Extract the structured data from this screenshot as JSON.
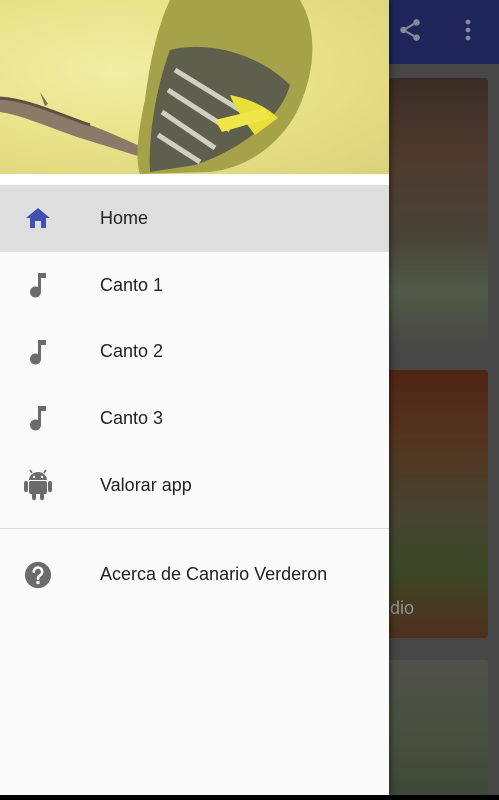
{
  "app": {
    "card_caption": "dio",
    "colors": {
      "toolbar": "#2d3a8c",
      "active_item": "#dedede",
      "home_icon": "#3f51b5",
      "menu_icon": "#6b6b6b"
    }
  },
  "toolbar": {
    "share_icon": "share-icon",
    "more_icon": "more-vert-icon"
  },
  "drawer": {
    "header_image": "yellow-bird-on-branch",
    "items": [
      {
        "label": "Home",
        "icon": "home-icon",
        "active": true
      },
      {
        "label": "Canto 1",
        "icon": "music-note-icon",
        "active": false
      },
      {
        "label": "Canto 2",
        "icon": "music-note-icon",
        "active": false
      },
      {
        "label": "Canto 3",
        "icon": "music-note-icon",
        "active": false
      },
      {
        "label": "Valorar app",
        "icon": "android-icon",
        "active": false
      }
    ],
    "about": {
      "label": "Acerca de Canario Verderon",
      "icon": "help-icon"
    }
  }
}
